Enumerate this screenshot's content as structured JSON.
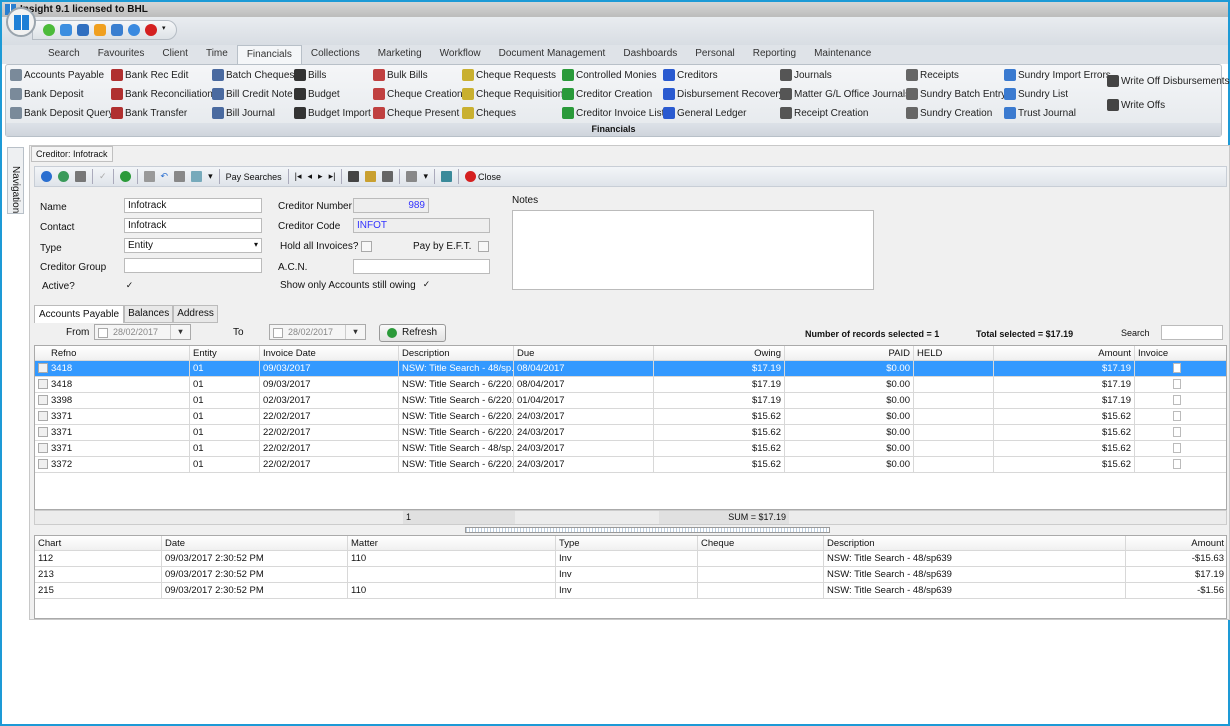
{
  "window": {
    "title": "Insight 9.1 licensed to BHL"
  },
  "menu_tabs": [
    "Search",
    "Favourites",
    "Client",
    "Time",
    "Financials",
    "Collections",
    "Marketing",
    "Workflow",
    "Document Management",
    "Dashboards",
    "Personal",
    "Reporting",
    "Maintenance"
  ],
  "active_menu_tab": "Financials",
  "ribbon": {
    "group_label": "Financials",
    "columns": [
      [
        "Accounts Payable",
        "Bank Deposit",
        "Bank Deposit Query"
      ],
      [
        "Bank Rec Edit",
        "Bank Reconciliation",
        "Bank Transfer"
      ],
      [
        "Batch Cheques",
        "Bill Credit Note",
        "Bill Journal"
      ],
      [
        "Bills",
        "Budget",
        "Budget Import"
      ],
      [
        "Bulk Bills",
        "Cheque Creation",
        "Cheque Present"
      ],
      [
        "Cheque Requests",
        "Cheque Requisition",
        "Cheques"
      ],
      [
        "Controlled Monies",
        "Creditor Creation",
        "Creditor Invoice List"
      ],
      [
        "Creditors",
        "Disbursement Recovery",
        "General Ledger"
      ],
      [
        "Journals",
        "Matter G/L Office Journals",
        "Receipt Creation"
      ],
      [
        "Receipts",
        "Sundry Batch Entry",
        "Sundry Creation"
      ],
      [
        "Sundry Import Errors",
        "Sundry List",
        "Trust Journal"
      ],
      [
        "Write Off Disbursements",
        "Write Offs"
      ]
    ]
  },
  "navigation_label": "Navigation",
  "document_tab": "Creditor: Infotrack",
  "toolbar": {
    "pay_searches": "Pay Searches",
    "close": "Close"
  },
  "form": {
    "name_label": "Name",
    "name": "Infotrack",
    "contact_label": "Contact",
    "contact": "Infotrack",
    "type_label": "Type",
    "type": "Entity",
    "group_label": "Creditor Group",
    "group": "",
    "active_label": "Active?",
    "active": true,
    "number_label": "Creditor Number",
    "number": "989",
    "code_label": "Creditor Code",
    "code": "INFOT",
    "hold_label": "Hold all Invoices?",
    "hold": false,
    "eft_label": "Pay by E.F.T.",
    "eft": false,
    "acn_label": "A.C.N.",
    "acn": "",
    "owing_only_label": "Show only Accounts still owing",
    "owing_only": true,
    "notes_label": "Notes",
    "notes": ""
  },
  "sub_tabs": [
    "Accounts Payable",
    "Balances",
    "Address"
  ],
  "filter": {
    "from_label": "From",
    "from": "28/02/2017",
    "to_label": "To",
    "to": "28/02/2017",
    "refresh": "Refresh",
    "records_selected": "Number of records selected = 1",
    "total_selected": "Total selected = $17.19",
    "search_label": "Search",
    "search": ""
  },
  "ap_grid": {
    "columns": [
      "Refno",
      "Entity",
      "Invoice Date",
      "Description",
      "Due",
      "Owing",
      "PAID",
      "HELD",
      "Amount",
      "Invoice"
    ],
    "rows": [
      [
        "3418",
        "01",
        "09/03/2017",
        "NSW: Title Search - 48/sp...",
        "08/04/2017",
        "$17.19",
        "$0.00",
        "",
        "$17.19"
      ],
      [
        "3418",
        "01",
        "09/03/2017",
        "NSW: Title Search - 6/220...",
        "08/04/2017",
        "$17.19",
        "$0.00",
        "",
        "$17.19"
      ],
      [
        "3398",
        "01",
        "02/03/2017",
        "NSW: Title Search - 6/220...",
        "01/04/2017",
        "$17.19",
        "$0.00",
        "",
        "$17.19"
      ],
      [
        "3371",
        "01",
        "22/02/2017",
        "NSW: Title Search - 6/220...",
        "24/03/2017",
        "$15.62",
        "$0.00",
        "",
        "$15.62"
      ],
      [
        "3371",
        "01",
        "22/02/2017",
        "NSW: Title Search - 6/220...",
        "24/03/2017",
        "$15.62",
        "$0.00",
        "",
        "$15.62"
      ],
      [
        "3371",
        "01",
        "22/02/2017",
        "NSW: Title Search - 48/sp...",
        "24/03/2017",
        "$15.62",
        "$0.00",
        "",
        "$15.62"
      ],
      [
        "3372",
        "01",
        "22/02/2017",
        "NSW: Title Search - 6/220...",
        "24/03/2017",
        "$15.62",
        "$0.00",
        "",
        "$15.62"
      ]
    ],
    "selected_row": 0,
    "footer_count": "1",
    "footer_sum": "SUM = $17.19"
  },
  "detail_grid": {
    "columns": [
      "Chart",
      "Date",
      "Matter",
      "Type",
      "Cheque",
      "Description",
      "Amount"
    ],
    "rows": [
      [
        "112",
        "09/03/2017 2:30:52 PM",
        "110",
        "Inv",
        "",
        "NSW: Title Search - 48/sp639",
        "-$15.63"
      ],
      [
        "213",
        "09/03/2017 2:30:52 PM",
        "",
        "Inv",
        "",
        "NSW: Title Search - 48/sp639",
        "$17.19"
      ],
      [
        "215",
        "09/03/2017 2:30:52 PM",
        "110",
        "Inv",
        "",
        "NSW: Title Search - 48/sp639",
        "-$1.56"
      ]
    ]
  },
  "colors": {
    "selection": "#3399ff",
    "window_border": "#1d9ad6",
    "code_text": "#3333ff"
  }
}
